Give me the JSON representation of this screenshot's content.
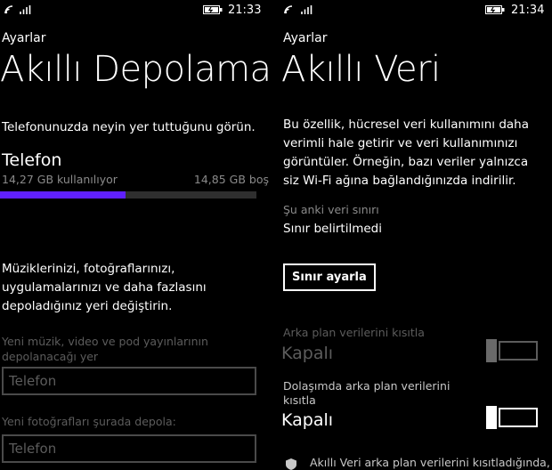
{
  "left": {
    "status": {
      "time": "21:33"
    },
    "app_title": "Ayarlar",
    "page_title": "Akıllı Depolama",
    "description": "Telefonunuzda neyin yer tuttuğunu görün.",
    "storage": {
      "device_label": "Telefon",
      "used_text": "14,27 GB kullanılıyor",
      "free_text": "14,85 GB boş",
      "used_fraction": 0.49
    },
    "change_text": "Müziklerinizi, fotoğraflarınızı, uygulamalarınızı ve daha fazlasını depoladığınız yeri değiştirin.",
    "media_store": {
      "label": "Yeni müzik, video ve pod yayınlarının depolanacağı yer",
      "value": "Telefon"
    },
    "photo_store": {
      "label": "Yeni fotoğrafları şurada depola:",
      "value": "Telefon"
    }
  },
  "right": {
    "status": {
      "time": "21:34"
    },
    "app_title": "Ayarlar",
    "page_title": "Akıllı Veri",
    "description": "Bu özellik, hücresel veri kullanımını daha verimli hale getirir ve veri kullanımınızı görüntüler. Örneğin, bazı veriler yalnızca siz Wi-Fi ağına bağlandığınızda indirilir.",
    "limit_label": "Şu anki veri sınırı",
    "limit_value": "Sınır belirtilmedi",
    "set_limit_button": "Sınır ayarla",
    "bg_restrict": {
      "label": "Arka plan verilerini kısıtla",
      "state": "Kapalı"
    },
    "roaming_restrict": {
      "label_line1": "Dolaşımda arka plan verilerini",
      "label_line2": "kısıtla",
      "state": "Kapalı"
    },
    "footer_text": "Akıllı Veri arka plan verilerini kısıtladığında,"
  },
  "colors": {
    "accent": "#6020ff",
    "background": "#000000"
  },
  "icons": [
    "signal-icon",
    "wifi-icon",
    "battery-icon"
  ]
}
